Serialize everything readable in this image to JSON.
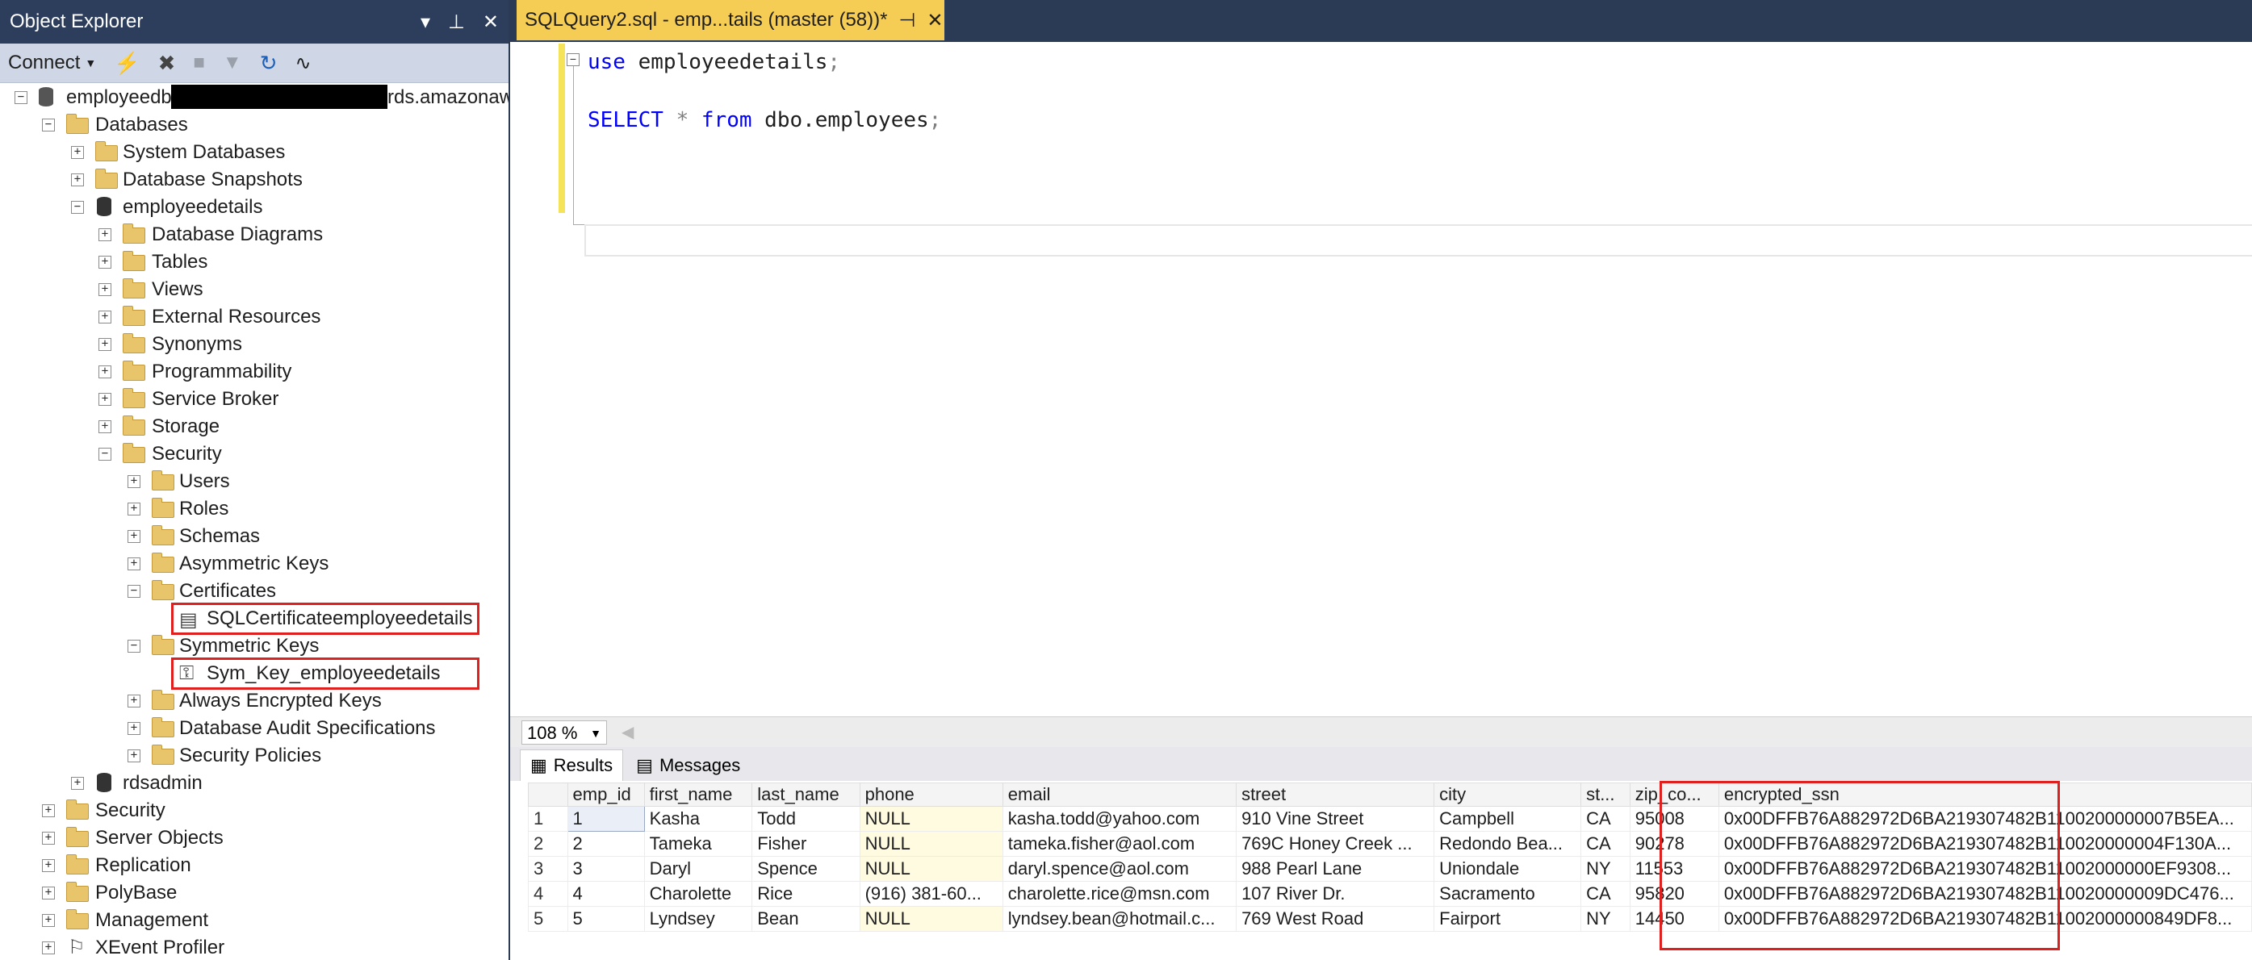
{
  "object_explorer": {
    "title": "Object Explorer",
    "toolbar": {
      "connect_label": "Connect"
    },
    "server": {
      "prefix": "employeedb",
      "suffix": "rds.amazonaw"
    },
    "tree": {
      "databases": "Databases",
      "system_databases": "System Databases",
      "database_snapshots": "Database Snapshots",
      "employeedetails": "employeedetails",
      "database_diagrams": "Database Diagrams",
      "tables": "Tables",
      "views": "Views",
      "external_resources": "External Resources",
      "synonyms": "Synonyms",
      "programmability": "Programmability",
      "service_broker": "Service Broker",
      "storage": "Storage",
      "security": "Security",
      "users": "Users",
      "roles": "Roles",
      "schemas": "Schemas",
      "asymmetric_keys": "Asymmetric Keys",
      "certificates": "Certificates",
      "certificate_item": "SQLCertificateemployeedetails",
      "symmetric_keys": "Symmetric Keys",
      "symmetric_key_item": "Sym_Key_employeedetails",
      "always_encrypted_keys": "Always Encrypted Keys",
      "database_audit_specs": "Database Audit Specifications",
      "security_policies": "Security Policies",
      "rdsadmin": "rdsadmin",
      "server_security": "Security",
      "server_objects": "Server Objects",
      "replication": "Replication",
      "polybase": "PolyBase",
      "management": "Management",
      "xevent_profiler": "XEvent Profiler"
    }
  },
  "editor": {
    "tab_title": "SQLQuery2.sql - emp...tails (master (58))*",
    "line1": {
      "kw": "use",
      "rest": " employeedetails",
      "semi": ";"
    },
    "line2": {
      "kw1": "SELECT",
      "star": " * ",
      "kw2": "from",
      "rest": " dbo.employees",
      "semi": ";"
    }
  },
  "zoom": "108 %",
  "results": {
    "tab_results": "Results",
    "tab_messages": "Messages",
    "columns": [
      "emp_id",
      "first_name",
      "last_name",
      "phone",
      "email",
      "street",
      "city",
      "st...",
      "zip_co...",
      "encrypted_ssn"
    ],
    "rows": [
      [
        "1",
        "1",
        "Kasha",
        "Todd",
        "NULL",
        "kasha.todd@yahoo.com",
        "910 Vine Street",
        "Campbell",
        "CA",
        "95008",
        "0x00DFFB76A882972D6BA219307482B1100200000007B5EA..."
      ],
      [
        "2",
        "2",
        "Tameka",
        "Fisher",
        "NULL",
        "tameka.fisher@aol.com",
        "769C Honey Creek ...",
        "Redondo Bea...",
        "CA",
        "90278",
        "0x00DFFB76A882972D6BA219307482B110020000004F130A..."
      ],
      [
        "3",
        "3",
        "Daryl",
        "Spence",
        "NULL",
        "daryl.spence@aol.com",
        "988 Pearl Lane",
        "Uniondale",
        "NY",
        "11553",
        "0x00DFFB76A882972D6BA219307482B11002000000EF9308..."
      ],
      [
        "4",
        "4",
        "Charolette",
        "Rice",
        "(916) 381-60...",
        "charolette.rice@msn.com",
        "107 River Dr.",
        "Sacramento",
        "CA",
        "95820",
        "0x00DFFB76A882972D6BA219307482B110020000009DC476..."
      ],
      [
        "5",
        "5",
        "Lyndsey",
        "Bean",
        "NULL",
        "lyndsey.bean@hotmail.c...",
        "769 West Road",
        "Fairport",
        "NY",
        "14450",
        "0x00DFFB76A882972D6BA219307482B11002000000849DF8..."
      ]
    ]
  }
}
